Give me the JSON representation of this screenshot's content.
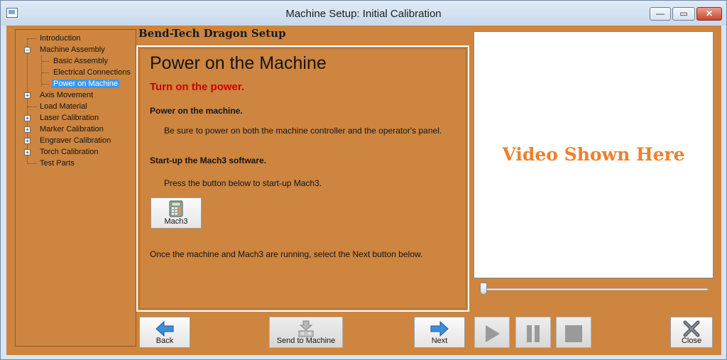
{
  "window": {
    "title": "Machine Setup: Initial Calibration"
  },
  "tree": {
    "items": [
      {
        "label": "Introduction"
      },
      {
        "label": "Machine Assembly",
        "expander": "−"
      },
      {
        "label": "Basic Assembly"
      },
      {
        "label": "Electrical Connections"
      },
      {
        "label": "Power on Machine",
        "selected": true
      },
      {
        "label": "Axis Movement",
        "expander": "+"
      },
      {
        "label": "Load Material"
      },
      {
        "label": "Laser Calibration",
        "expander": "+"
      },
      {
        "label": "Marker Calibration",
        "expander": "+"
      },
      {
        "label": "Engraver Calibration",
        "expander": "+"
      },
      {
        "label": "Torch Calibration",
        "expander": "+"
      },
      {
        "label": "Test Parts"
      }
    ]
  },
  "header": {
    "title": "Bend-Tech Dragon Setup"
  },
  "content": {
    "title": "Power on the Machine",
    "subtitle": "Turn on the power.",
    "step1_heading": "Power on the machine.",
    "step1_text": "Be sure to power on both the machine controller and the operator's panel.",
    "step2_heading": "Start-up the Mach3 software.",
    "step2_text": "Press the button below to start-up Mach3.",
    "mach3_button": "Mach3",
    "footer_text": "Once the machine and Mach3 are running, select the Next button below."
  },
  "video": {
    "placeholder": "Video Shown Here",
    "progress": 0
  },
  "toolbar": {
    "back": "Back",
    "send": "Send to Machine",
    "next": "Next",
    "close": "Close"
  },
  "colors": {
    "background": "#cd853f",
    "video_text": "#f07f2a",
    "subtitle": "#cc0000",
    "selection": "#3399ff"
  },
  "icons": {
    "back": "arrow-left-icon",
    "send": "send-to-machine-icon",
    "next": "arrow-right-icon",
    "play": "play-icon",
    "pause": "pause-icon",
    "stop": "stop-icon",
    "close": "close-x-icon",
    "mach3": "calculator-icon"
  }
}
